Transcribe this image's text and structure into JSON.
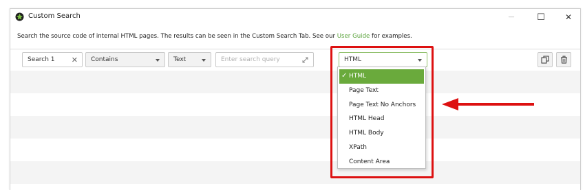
{
  "window": {
    "title": "Custom Search",
    "controls": {
      "minimize": "—",
      "maximize": "☐",
      "close": "✕"
    }
  },
  "description": {
    "before_link": "Search the source code of internal HTML pages. The results can be seen in the Custom Search Tab. See our ",
    "link": "User Guide",
    "after_link": " for examples."
  },
  "filter_row": {
    "search_name": "Search 1",
    "match_mode": "Contains",
    "query_type": "Text",
    "query_placeholder": "Enter search query",
    "search_in": "HTML"
  },
  "dropdown": {
    "options": [
      "HTML",
      "Page Text",
      "Page Text No Anchors",
      "HTML Head",
      "HTML Body",
      "XPath",
      "Content Area"
    ],
    "selected": "HTML"
  },
  "colors": {
    "accent_green": "#6aaa3c",
    "link_green": "#5aa33b",
    "highlight_red": "#dd1111"
  },
  "icons": [
    "app-logo-icon",
    "clear-icon",
    "expand-icon",
    "duplicate-icon",
    "trash-icon",
    "check-icon"
  ]
}
